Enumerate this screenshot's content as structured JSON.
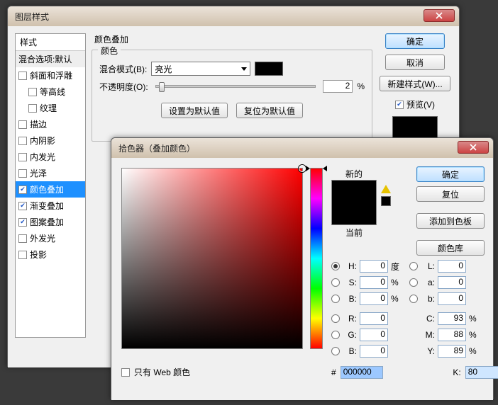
{
  "ls": {
    "title": "图层样式",
    "stylesHeader": "样式",
    "blendDefault": "混合选项:默认",
    "items": [
      "斜面和浮雕",
      "等高线",
      "纹理",
      "描边",
      "内阴影",
      "内发光",
      "光泽",
      "颜色叠加",
      "渐变叠加",
      "图案叠加",
      "外发光",
      "投影"
    ],
    "groupTitle": "颜色叠加",
    "innerGroup": "颜色",
    "blendModeLabel": "混合模式(B):",
    "blendModeValue": "亮光",
    "opacityLabel": "不透明度(O):",
    "opacityValue": "2",
    "opacityUnit": "%",
    "setDefault": "设置为默认值",
    "resetDefault": "复位为默认值",
    "ok": "确定",
    "cancel": "取消",
    "newStyle": "新建样式(W)...",
    "preview": "预览(V)"
  },
  "cp": {
    "title": "拾色器（叠加颜色）",
    "newLabel": "新的",
    "currentLabel": "当前",
    "ok": "确定",
    "reset": "复位",
    "addSwatch": "添加到色板",
    "colorLib": "颜色库",
    "H": "0",
    "S": "0",
    "Bv": "0",
    "L": "0",
    "a": "0",
    "b": "0",
    "R": "0",
    "G": "0",
    "Bc": "0",
    "C": "93",
    "M": "88",
    "Y": "89",
    "K": "80",
    "deg": "度",
    "pct": "%",
    "hex": "000000",
    "webOnly": "只有 Web 颜色",
    "hL": "H:",
    "sL": "S:",
    "bL": "B:",
    "lL": "L:",
    "aL": "a:",
    "bbL": "b:",
    "rL": "R:",
    "gL": "G:",
    "b2L": "B:",
    "cL": "C:",
    "mL": "M:",
    "yL": "Y:",
    "kL": "K:"
  }
}
